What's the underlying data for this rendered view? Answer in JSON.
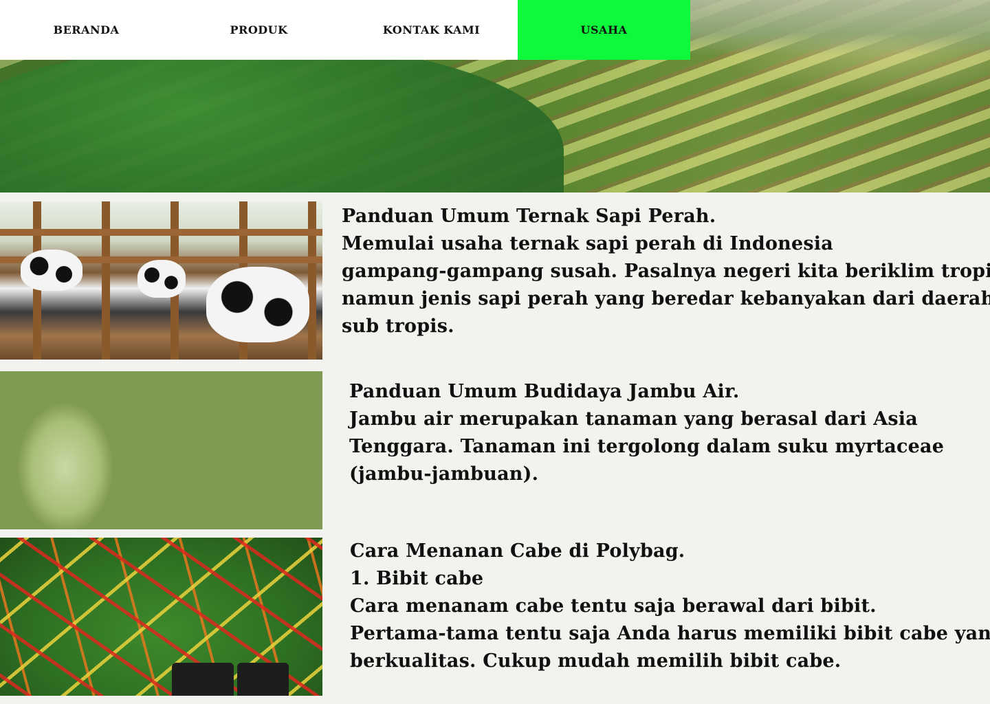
{
  "nav": {
    "items": [
      {
        "label": "BERANDA"
      },
      {
        "label": "PRODUK"
      },
      {
        "label": "KONTAK KAMI"
      },
      {
        "label": "USAHA"
      }
    ],
    "active_index": 3,
    "active_color": "#0ef83c"
  },
  "articles": [
    {
      "image_subject": "dairy-cows",
      "lines": [
        "Panduan Umum Ternak Sapi Perah.",
        "Memulai usaha ternak sapi perah di Indonesia",
        "gampang-gampang susah. Pasalnya negeri kita beriklim tropis",
        "namun jenis sapi perah yang beredar kebanyakan dari daerah",
        "sub tropis."
      ]
    },
    {
      "image_subject": "water-apples",
      "lines": [
        "Panduan Umum Budidaya Jambu Air.",
        "Jambu air merupakan tanaman yang berasal dari Asia",
        "Tenggara. Tanaman ini tergolong dalam suku myrtaceae",
        "(jambu-jambuan)."
      ]
    },
    {
      "image_subject": "chili-plants",
      "lines": [
        "Cara Menanan Cabe di Polybag.",
        "1. Bibit cabe",
        "Cara menanam cabe tentu saja berawal dari bibit.",
        "Pertama-tama tentu saja Anda harus memiliki bibit cabe yang",
        "berkualitas. Cukup mudah memilih bibit cabe."
      ]
    }
  ]
}
